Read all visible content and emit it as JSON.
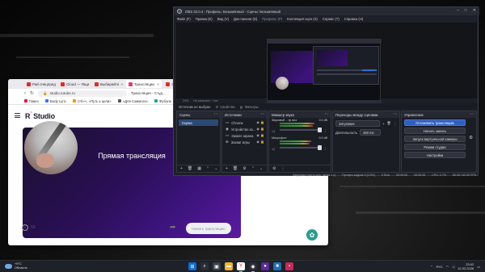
{
  "browser": {
    "tabs": [
      {
        "label": "Рай спецпред",
        "color": "#d93025",
        "active": false
      },
      {
        "label": "Cloud — Ящи",
        "color": "#d93025",
        "active": false
      },
      {
        "label": "Выбирайте",
        "color": "#d93025",
        "active": false
      },
      {
        "label": "Трансляции",
        "color": "#e03e6e",
        "active": true
      },
      {
        "label": "Эрмитаж",
        "color": "#d93025",
        "active": false
      },
      {
        "label": "Миро",
        "color": "#3a6ff7",
        "active": false
      }
    ],
    "url": "studio.rutube.ru",
    "page_title": "Трансляция - Студ...",
    "bookmarks": [
      "Гамес",
      "Body Lyric",
      "стб»», «Путь к цели»",
      "«Для Сажмога»",
      "Фубопо"
    ],
    "logo": "R",
    "logo_sup": "'",
    "logo_rest": "Studio",
    "player_title": "Прямая трансляция",
    "start_button": "Начать трансляцию",
    "info_text": "10"
  },
  "obs": {
    "title": "OBS 32.0.4 - Профиль: Безымянный - Сцены: Безымянный",
    "menu": [
      "Файл (F)",
      "Правка (E)",
      "Вид (V)",
      "Док-панели (D)",
      "Профиль (P)",
      "Коллекция сцен (S)",
      "Сервис (T)",
      "Справка (H)"
    ],
    "strip_items": [
      "24%",
      "Не записано ~ нет"
    ],
    "source_bar_label": "Источник не выбран",
    "properties_tab": "Свойства",
    "filters_tab": "Фильтры",
    "docks": {
      "scenes": {
        "title": "Сцены",
        "items": [
          "Сцена"
        ]
      },
      "sources": {
        "title": "Источники",
        "items": [
          {
            "label": "Chrome",
            "icon": "monitor"
          },
          {
            "label": "Устройство за...",
            "icon": "camera"
          },
          {
            "label": "Захват экрана",
            "icon": "monitor"
          },
          {
            "label": "Захват игры",
            "icon": "gamepad"
          }
        ]
      },
      "mixer": {
        "title": "Микшер звука",
        "channels": [
          {
            "name": "Звуковой ...тр виз",
            "db": "0.0 dB",
            "level": 0.62
          },
          {
            "name": "Микрофон",
            "db": "0.0 dB",
            "level": 0.55
          }
        ]
      },
      "transitions": {
        "title": "Переходы между сценами",
        "type": "Затухание",
        "duration_label": "Длительность",
        "duration": "250 ms"
      },
      "controls": {
        "title": "Управление",
        "buttons": [
          "Остановить трансляцию",
          "Начать запись",
          "Запуск виртуальной камеры",
          "Режим студии",
          "Настройки"
        ]
      }
    },
    "status": [
      "Задержка (часто-изл. через 1 с)",
      "Пропуск кадров 0 (0.0%)",
      "0 Kb/s",
      "00:00:00",
      "00:00:00",
      "CPU: 2.7%",
      "60.00 / 60.00 FPS"
    ]
  },
  "taskbar": {
    "weather_temp": "+9°C",
    "weather_desc": "Облачно",
    "lang": "РУС",
    "time": "23:02",
    "date": "12.02.2026"
  },
  "colors": {
    "accent": "#2f5fbf",
    "rutube_pink": "#ff3d6e",
    "player": "#3b137a"
  }
}
